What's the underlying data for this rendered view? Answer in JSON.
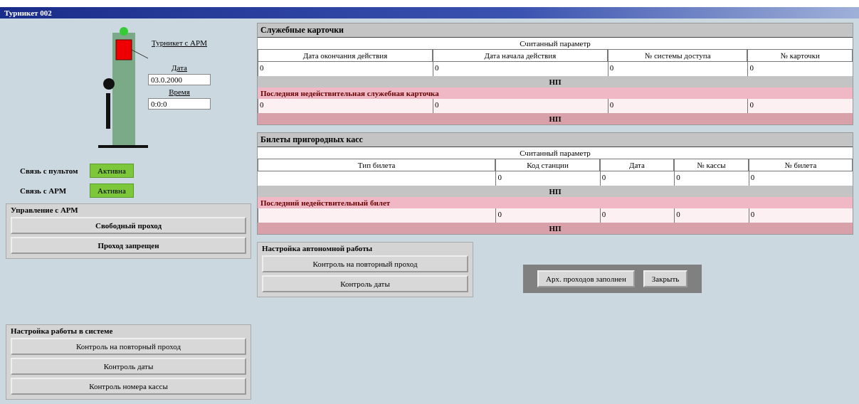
{
  "window": {
    "title": "Турникет 002"
  },
  "turnstile": {
    "link": "Турникет с АРМ",
    "date_label": "Дата",
    "date": "03.0.2000",
    "time_label": "Время",
    "time": "0:0:0"
  },
  "links": [
    {
      "label": "Связь с пультом",
      "value": "Активна",
      "active": true
    },
    {
      "label": "Связь с АРМ",
      "value": "Активна",
      "active": true
    }
  ],
  "arm_control": {
    "title": "Управление с АРМ",
    "buttons": [
      "Свободный проход",
      "Проход запрещен"
    ]
  },
  "system_settings": {
    "title": "Настройка работы в системе",
    "buttons": [
      "Контроль на повторный проход",
      "Контроль даты",
      "Контроль номера кассы"
    ]
  },
  "service_cards": {
    "title": "Служебные карточки",
    "header": "Считанный параметр",
    "columns": [
      {
        "label": "Дата окончания действия",
        "value": "0",
        "invalid": "0"
      },
      {
        "label": "Дата начала действия",
        "value": "0",
        "invalid": "0"
      },
      {
        "label": "№ системы доступа",
        "value": "0",
        "invalid": "0"
      },
      {
        "label": "№ карточки",
        "value": "0",
        "invalid": "0"
      }
    ],
    "status": "НП",
    "invalid_title": "Последняя недействительная служебная карточка",
    "invalid_status": "НП"
  },
  "tickets": {
    "title": "Билеты пригородных касс",
    "header": "Считанный параметр",
    "columns": [
      {
        "label": "Тип билета"
      },
      {
        "label": "Код станции",
        "value": "0",
        "invalid": "0"
      },
      {
        "label": "Дата",
        "value": "0",
        "invalid": "0"
      },
      {
        "label": "№ кассы",
        "value": "0",
        "invalid": "0"
      },
      {
        "label": "№ билета",
        "value": "0",
        "invalid": "0"
      }
    ],
    "status": "НП",
    "invalid_title": "Последний недействительный билет",
    "invalid_status": "НП"
  },
  "autonomous": {
    "title": "Настройка автономной работы",
    "buttons": [
      "Контроль на повторный проход",
      "Контроль даты"
    ]
  },
  "footer": {
    "archive_status": "Арх. проходов заполнен",
    "close": "Закрыть"
  }
}
